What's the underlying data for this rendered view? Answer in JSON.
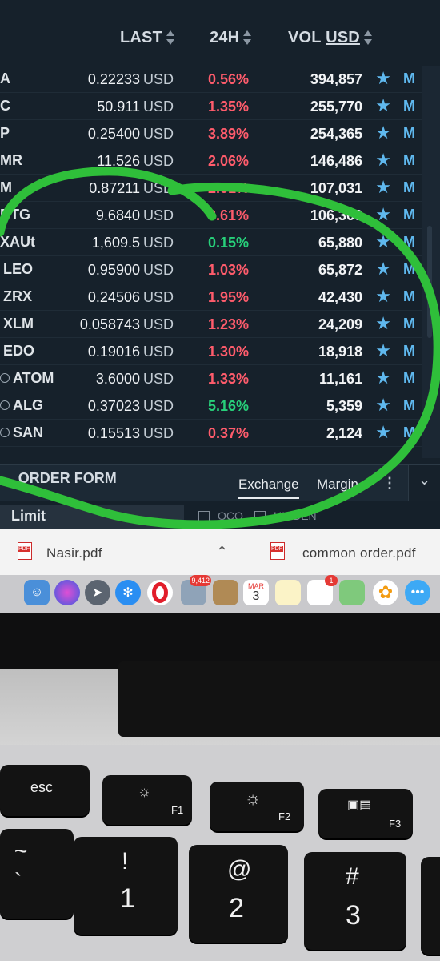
{
  "header": {
    "col_last": "LAST",
    "col_24h": "24H",
    "col_vol": "VOL",
    "col_vol_unit": "USD"
  },
  "rows": [
    {
      "symbol": "A",
      "last": "0.22233",
      "currency": "USD",
      "change": "0.56%",
      "change_dir": "neg",
      "volume": "394,857",
      "action": "M"
    },
    {
      "symbol": "C",
      "last": "50.911",
      "currency": "USD",
      "change": "1.35%",
      "change_dir": "neg",
      "volume": "255,770",
      "action": "M"
    },
    {
      "symbol": "P",
      "last": "0.25400",
      "currency": "USD",
      "change": "3.89%",
      "change_dir": "neg",
      "volume": "254,365",
      "action": "M"
    },
    {
      "symbol": "MR",
      "last": "11.526",
      "currency": "USD",
      "change": "2.06%",
      "change_dir": "neg",
      "volume": "146,486",
      "action": "M"
    },
    {
      "symbol": "M",
      "last": "0.87211",
      "currency": "USD",
      "change": "2.01%",
      "change_dir": "neg",
      "volume": "107,031",
      "action": "M"
    },
    {
      "symbol": "BTG",
      "last": "9.6840",
      "currency": "USD",
      "change": "3.61%",
      "change_dir": "neg",
      "volume": "106,369",
      "action": "M"
    },
    {
      "symbol": "XAUt",
      "last": "1,609.5",
      "currency": "USD",
      "change": "0.15%",
      "change_dir": "pos",
      "volume": "65,880",
      "action": "M"
    },
    {
      "symbol": "LEO",
      "last": "0.95900",
      "currency": "USD",
      "change": "1.03%",
      "change_dir": "neg",
      "volume": "65,872",
      "action": "M"
    },
    {
      "symbol": "ZRX",
      "last": "0.24506",
      "currency": "USD",
      "change": "1.95%",
      "change_dir": "neg",
      "volume": "42,430",
      "action": "M"
    },
    {
      "symbol": "XLM",
      "last": "0.058743",
      "currency": "USD",
      "change": "1.23%",
      "change_dir": "neg",
      "volume": "24,209",
      "action": "M"
    },
    {
      "symbol": "EDO",
      "last": "0.19016",
      "currency": "USD",
      "change": "1.30%",
      "change_dir": "neg",
      "volume": "18,918",
      "action": "M"
    },
    {
      "symbol": "ATOM",
      "last": "3.6000",
      "currency": "USD",
      "change": "1.33%",
      "change_dir": "neg",
      "volume": "11,161",
      "action": "M"
    },
    {
      "symbol": "ALG",
      "last": "0.37023",
      "currency": "USD",
      "change": "5.16%",
      "change_dir": "pos",
      "volume": "5,359",
      "action": "M"
    },
    {
      "symbol": "SAN",
      "last": "0.15513",
      "currency": "USD",
      "change": "0.37%",
      "change_dir": "neg",
      "volume": "2,124",
      "action": "M"
    }
  ],
  "order_form": {
    "title": "ORDER FORM",
    "tab_exchange": "Exchange",
    "tab_margin": "Margin",
    "order_type": "Limit",
    "option_oco": "OCO",
    "option_hidden": "HIDDEN"
  },
  "downloads": [
    {
      "name": "Nasir.pdf"
    },
    {
      "name": "common order.pdf"
    }
  ],
  "dock": {
    "calendar_month": "MAR",
    "calendar_day": "3",
    "photos_badge": "9,412",
    "reminders_badge": "1"
  },
  "keyboard": {
    "esc": "esc",
    "f1": "F1",
    "f2": "F2",
    "f3": "F3",
    "tilde_top": "~",
    "tilde_bottom": "`",
    "one_top": "!",
    "one_bottom": "1",
    "two_top": "@",
    "two_bottom": "2",
    "three_top": "#",
    "three_bottom": "3"
  },
  "colors": {
    "negative": "#ff5c6c",
    "positive": "#27d07a",
    "accent": "#5fb8ee",
    "highlight_marker": "#2fbf3a"
  }
}
